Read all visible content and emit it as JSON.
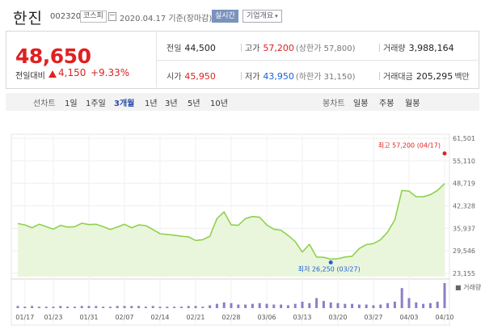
{
  "header": {
    "name": "한진",
    "code": "002320",
    "market": "코스피",
    "date_text": "2020.04.17 기준(장마감)",
    "realtime_label": "실시간",
    "overview_label": "기업개요"
  },
  "summary": {
    "price": "48,650",
    "change_label": "전일대비",
    "change_value": "4,150",
    "change_pct": "+9.33%",
    "prev_label": "전일",
    "prev_value": "44,500",
    "high_label": "고가",
    "high_value": "57,200",
    "upper_limit": "(상한가 57,800)",
    "volume_label": "거래량",
    "volume_value": "3,988,164",
    "open_label": "시가",
    "open_value": "45,950",
    "low_label": "저가",
    "low_value": "43,950",
    "lower_limit": "(하한가 31,150)",
    "amount_label": "거래대금",
    "amount_value": "205,295",
    "amount_unit": "백만"
  },
  "periods": {
    "line_chart_label": "선차트",
    "items": [
      "1일",
      "1주일",
      "3개월",
      "1년",
      "3년",
      "5년",
      "10년"
    ],
    "active": "3개월",
    "candle_label": "봉차트",
    "candle_items": [
      "일봉",
      "주봉",
      "월봉"
    ]
  },
  "colors": {
    "line": "#8fd14f",
    "fill": "#eaf6dc",
    "up": "#e02020",
    "down": "#1b5fd6",
    "volume": "#8a7fc9"
  },
  "chart_data": {
    "type": "area",
    "yticks": [
      "61,501",
      "55,110",
      "48,719",
      "42,328",
      "35,937",
      "29,546",
      "23,155"
    ],
    "ylim": [
      23155,
      61501
    ],
    "x_ticks": [
      "01/17",
      "01/23",
      "01/31",
      "02/07",
      "02/14",
      "02/21",
      "02/28",
      "03/06",
      "03/13",
      "03/20",
      "03/27",
      "04/03",
      "04/10"
    ],
    "x_tick_index": [
      1,
      5,
      10,
      15,
      20,
      25,
      30,
      35,
      40,
      45,
      50,
      55,
      60
    ],
    "values": [
      37300,
      36900,
      36100,
      37100,
      36400,
      35700,
      36800,
      36300,
      36400,
      37400,
      37000,
      37100,
      36400,
      35600,
      36300,
      37100,
      36100,
      36900,
      36700,
      35600,
      34400,
      34200,
      34000,
      33700,
      33500,
      32500,
      32700,
      33700,
      38700,
      40600,
      36900,
      36800,
      38700,
      39300,
      39100,
      36900,
      35700,
      35400,
      33900,
      32200,
      29200,
      31400,
      27800,
      27700,
      27200,
      27300,
      27800,
      28000,
      30200,
      31300,
      31600,
      32700,
      34900,
      38300,
      46700,
      46500,
      44900,
      44900,
      45500,
      46700,
      48650
    ],
    "volume": [
      3,
      2,
      3,
      2,
      2,
      2,
      3,
      2,
      2,
      3,
      3,
      3,
      2,
      2,
      3,
      3,
      3,
      3,
      2,
      3,
      2,
      2,
      2,
      2,
      3,
      3,
      2,
      4,
      6,
      8,
      7,
      5,
      5,
      6,
      7,
      6,
      5,
      5,
      4,
      6,
      9,
      7,
      14,
      10,
      8,
      7,
      6,
      6,
      5,
      5,
      4,
      5,
      7,
      9,
      28,
      14,
      8,
      6,
      7,
      9,
      35
    ],
    "volume_label": "거래량",
    "max_annotation": "최고 57,200 (04/17)",
    "min_annotation": "최저 26,250 (03/27)",
    "max_value": 57200,
    "min_value": 26250,
    "max_index": 60,
    "min_index": 44
  }
}
